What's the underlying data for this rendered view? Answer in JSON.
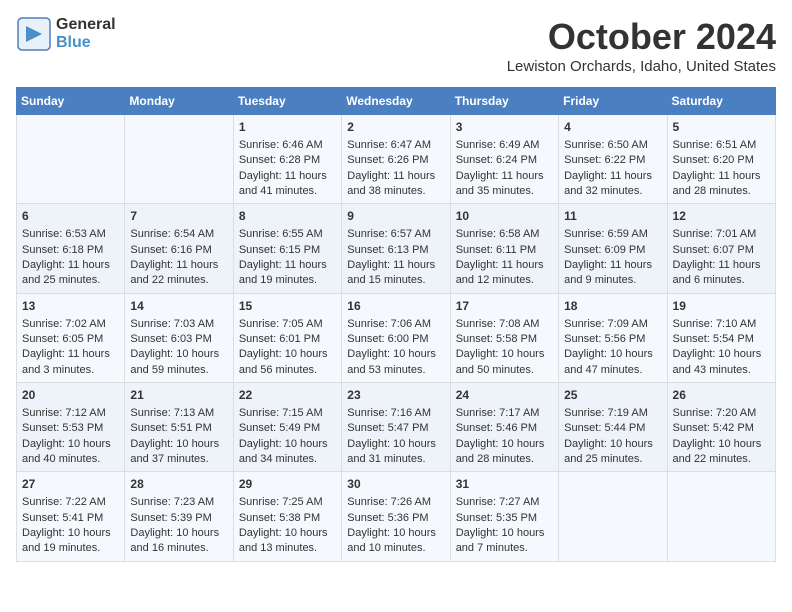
{
  "header": {
    "logo": {
      "general": "General",
      "blue": "Blue",
      "icon_unicode": "▶"
    },
    "title": "October 2024",
    "location": "Lewiston Orchards, Idaho, United States"
  },
  "weekdays": [
    "Sunday",
    "Monday",
    "Tuesday",
    "Wednesday",
    "Thursday",
    "Friday",
    "Saturday"
  ],
  "weeks": [
    [
      {
        "day": "",
        "sunrise": "",
        "sunset": "",
        "daylight": ""
      },
      {
        "day": "",
        "sunrise": "",
        "sunset": "",
        "daylight": ""
      },
      {
        "day": "1",
        "sunrise": "Sunrise: 6:46 AM",
        "sunset": "Sunset: 6:28 PM",
        "daylight": "Daylight: 11 hours and 41 minutes."
      },
      {
        "day": "2",
        "sunrise": "Sunrise: 6:47 AM",
        "sunset": "Sunset: 6:26 PM",
        "daylight": "Daylight: 11 hours and 38 minutes."
      },
      {
        "day": "3",
        "sunrise": "Sunrise: 6:49 AM",
        "sunset": "Sunset: 6:24 PM",
        "daylight": "Daylight: 11 hours and 35 minutes."
      },
      {
        "day": "4",
        "sunrise": "Sunrise: 6:50 AM",
        "sunset": "Sunset: 6:22 PM",
        "daylight": "Daylight: 11 hours and 32 minutes."
      },
      {
        "day": "5",
        "sunrise": "Sunrise: 6:51 AM",
        "sunset": "Sunset: 6:20 PM",
        "daylight": "Daylight: 11 hours and 28 minutes."
      }
    ],
    [
      {
        "day": "6",
        "sunrise": "Sunrise: 6:53 AM",
        "sunset": "Sunset: 6:18 PM",
        "daylight": "Daylight: 11 hours and 25 minutes."
      },
      {
        "day": "7",
        "sunrise": "Sunrise: 6:54 AM",
        "sunset": "Sunset: 6:16 PM",
        "daylight": "Daylight: 11 hours and 22 minutes."
      },
      {
        "day": "8",
        "sunrise": "Sunrise: 6:55 AM",
        "sunset": "Sunset: 6:15 PM",
        "daylight": "Daylight: 11 hours and 19 minutes."
      },
      {
        "day": "9",
        "sunrise": "Sunrise: 6:57 AM",
        "sunset": "Sunset: 6:13 PM",
        "daylight": "Daylight: 11 hours and 15 minutes."
      },
      {
        "day": "10",
        "sunrise": "Sunrise: 6:58 AM",
        "sunset": "Sunset: 6:11 PM",
        "daylight": "Daylight: 11 hours and 12 minutes."
      },
      {
        "day": "11",
        "sunrise": "Sunrise: 6:59 AM",
        "sunset": "Sunset: 6:09 PM",
        "daylight": "Daylight: 11 hours and 9 minutes."
      },
      {
        "day": "12",
        "sunrise": "Sunrise: 7:01 AM",
        "sunset": "Sunset: 6:07 PM",
        "daylight": "Daylight: 11 hours and 6 minutes."
      }
    ],
    [
      {
        "day": "13",
        "sunrise": "Sunrise: 7:02 AM",
        "sunset": "Sunset: 6:05 PM",
        "daylight": "Daylight: 11 hours and 3 minutes."
      },
      {
        "day": "14",
        "sunrise": "Sunrise: 7:03 AM",
        "sunset": "Sunset: 6:03 PM",
        "daylight": "Daylight: 10 hours and 59 minutes."
      },
      {
        "day": "15",
        "sunrise": "Sunrise: 7:05 AM",
        "sunset": "Sunset: 6:01 PM",
        "daylight": "Daylight: 10 hours and 56 minutes."
      },
      {
        "day": "16",
        "sunrise": "Sunrise: 7:06 AM",
        "sunset": "Sunset: 6:00 PM",
        "daylight": "Daylight: 10 hours and 53 minutes."
      },
      {
        "day": "17",
        "sunrise": "Sunrise: 7:08 AM",
        "sunset": "Sunset: 5:58 PM",
        "daylight": "Daylight: 10 hours and 50 minutes."
      },
      {
        "day": "18",
        "sunrise": "Sunrise: 7:09 AM",
        "sunset": "Sunset: 5:56 PM",
        "daylight": "Daylight: 10 hours and 47 minutes."
      },
      {
        "day": "19",
        "sunrise": "Sunrise: 7:10 AM",
        "sunset": "Sunset: 5:54 PM",
        "daylight": "Daylight: 10 hours and 43 minutes."
      }
    ],
    [
      {
        "day": "20",
        "sunrise": "Sunrise: 7:12 AM",
        "sunset": "Sunset: 5:53 PM",
        "daylight": "Daylight: 10 hours and 40 minutes."
      },
      {
        "day": "21",
        "sunrise": "Sunrise: 7:13 AM",
        "sunset": "Sunset: 5:51 PM",
        "daylight": "Daylight: 10 hours and 37 minutes."
      },
      {
        "day": "22",
        "sunrise": "Sunrise: 7:15 AM",
        "sunset": "Sunset: 5:49 PM",
        "daylight": "Daylight: 10 hours and 34 minutes."
      },
      {
        "day": "23",
        "sunrise": "Sunrise: 7:16 AM",
        "sunset": "Sunset: 5:47 PM",
        "daylight": "Daylight: 10 hours and 31 minutes."
      },
      {
        "day": "24",
        "sunrise": "Sunrise: 7:17 AM",
        "sunset": "Sunset: 5:46 PM",
        "daylight": "Daylight: 10 hours and 28 minutes."
      },
      {
        "day": "25",
        "sunrise": "Sunrise: 7:19 AM",
        "sunset": "Sunset: 5:44 PM",
        "daylight": "Daylight: 10 hours and 25 minutes."
      },
      {
        "day": "26",
        "sunrise": "Sunrise: 7:20 AM",
        "sunset": "Sunset: 5:42 PM",
        "daylight": "Daylight: 10 hours and 22 minutes."
      }
    ],
    [
      {
        "day": "27",
        "sunrise": "Sunrise: 7:22 AM",
        "sunset": "Sunset: 5:41 PM",
        "daylight": "Daylight: 10 hours and 19 minutes."
      },
      {
        "day": "28",
        "sunrise": "Sunrise: 7:23 AM",
        "sunset": "Sunset: 5:39 PM",
        "daylight": "Daylight: 10 hours and 16 minutes."
      },
      {
        "day": "29",
        "sunrise": "Sunrise: 7:25 AM",
        "sunset": "Sunset: 5:38 PM",
        "daylight": "Daylight: 10 hours and 13 minutes."
      },
      {
        "day": "30",
        "sunrise": "Sunrise: 7:26 AM",
        "sunset": "Sunset: 5:36 PM",
        "daylight": "Daylight: 10 hours and 10 minutes."
      },
      {
        "day": "31",
        "sunrise": "Sunrise: 7:27 AM",
        "sunset": "Sunset: 5:35 PM",
        "daylight": "Daylight: 10 hours and 7 minutes."
      },
      {
        "day": "",
        "sunrise": "",
        "sunset": "",
        "daylight": ""
      },
      {
        "day": "",
        "sunrise": "",
        "sunset": "",
        "daylight": ""
      }
    ]
  ]
}
